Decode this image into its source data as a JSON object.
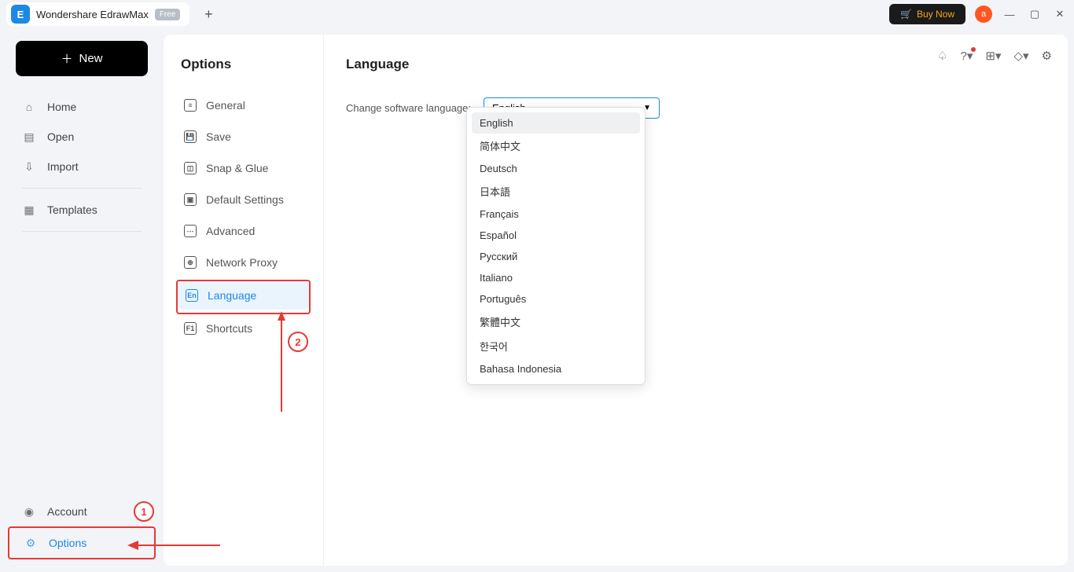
{
  "titlebar": {
    "app_name": "Wondershare EdrawMax",
    "badge": "Free",
    "buy_now": "Buy Now",
    "avatar_letter": "a"
  },
  "sidebar": {
    "new_label": "New",
    "items": [
      "Home",
      "Open",
      "Import",
      "Templates"
    ],
    "account_label": "Account",
    "options_label": "Options"
  },
  "options": {
    "title": "Options",
    "items": [
      "General",
      "Save",
      "Snap & Glue",
      "Default Settings",
      "Advanced",
      "Network Proxy",
      "Language",
      "Shortcuts"
    ],
    "active_index": 6
  },
  "language": {
    "title": "Language",
    "change_label": "Change software language:",
    "selected": "English",
    "options": [
      "English",
      "简体中文",
      "Deutsch",
      "日本語",
      "Français",
      "Español",
      "Русский",
      "Italiano",
      "Português",
      "繁體中文",
      "한국어",
      "Bahasa Indonesia"
    ]
  },
  "annotations": {
    "step1": "1",
    "step2": "2"
  }
}
